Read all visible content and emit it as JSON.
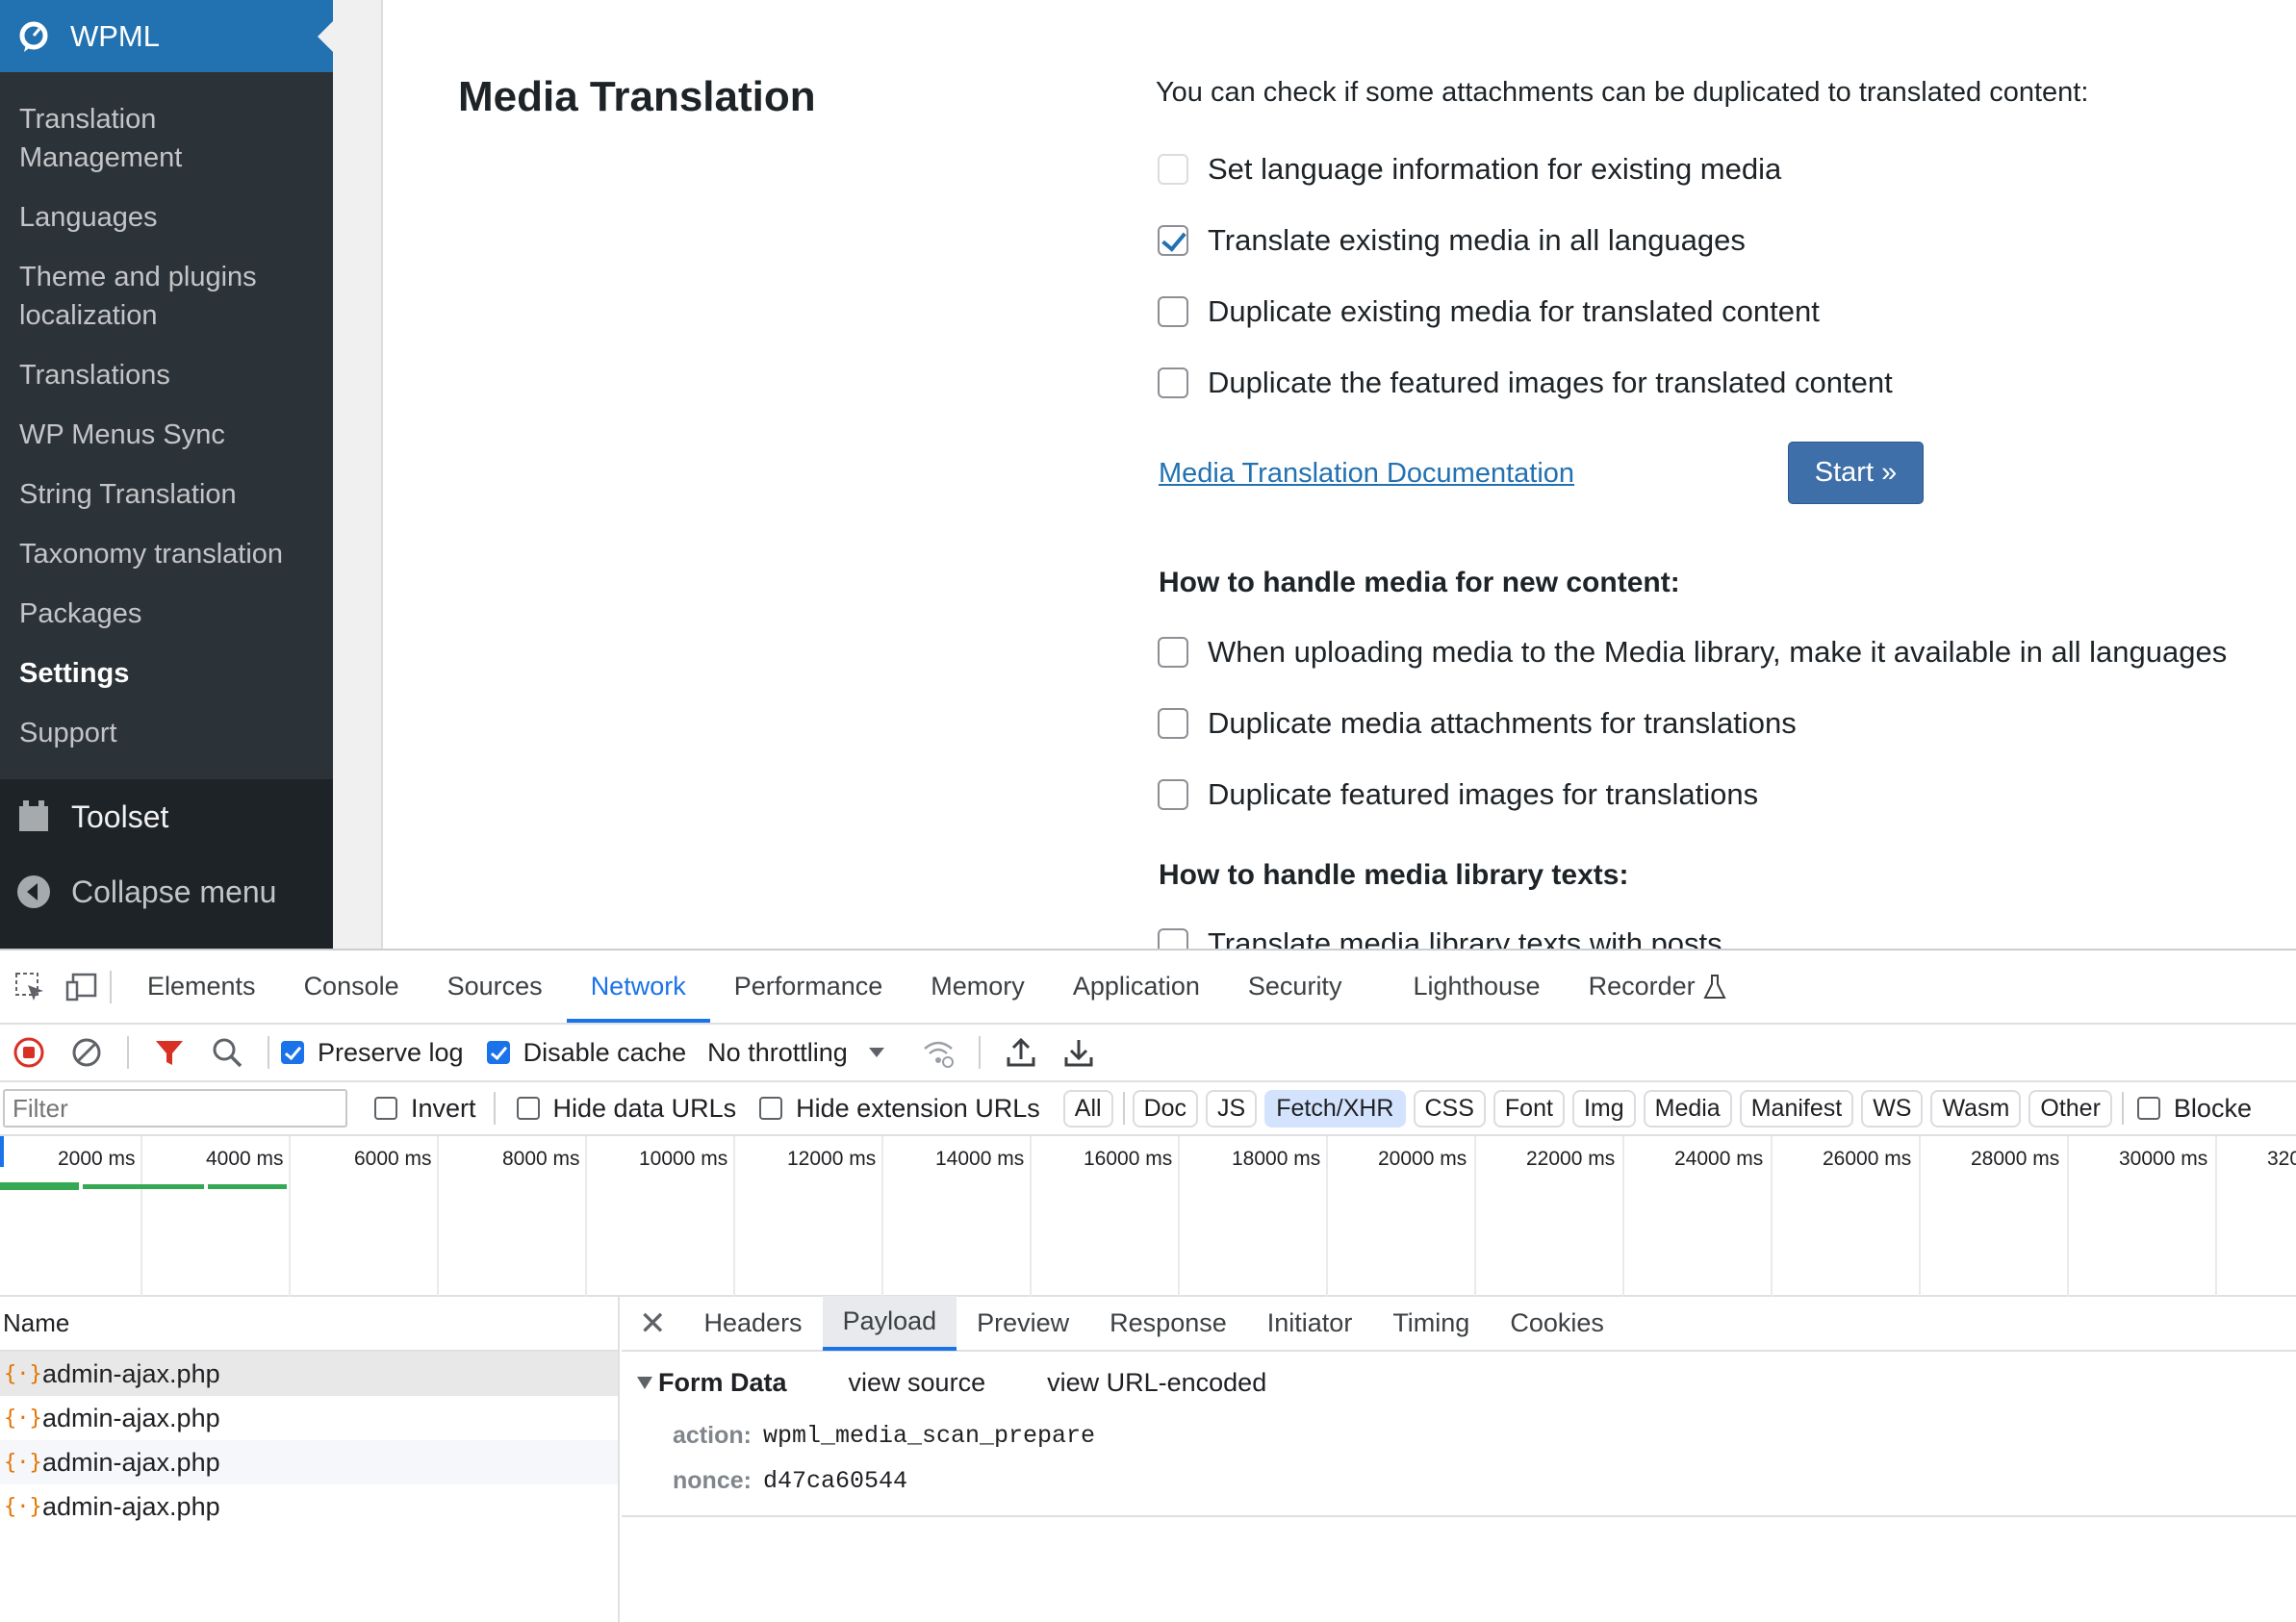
{
  "sidebar": {
    "plugin_name": "WPML",
    "items": [
      {
        "label": "Translation Management"
      },
      {
        "label": "Languages"
      },
      {
        "label": "Theme and plugins localization"
      },
      {
        "label": "Translations"
      },
      {
        "label": "WP Menus Sync"
      },
      {
        "label": "String Translation"
      },
      {
        "label": "Taxonomy translation"
      },
      {
        "label": "Packages"
      },
      {
        "label": "Settings",
        "current": true
      },
      {
        "label": "Support"
      }
    ],
    "toolset_label": "Toolset",
    "collapse_label": "Collapse menu"
  },
  "content": {
    "title": "Media Translation",
    "intro": "You can check if some attachments can be duplicated to translated content:",
    "existing_options": [
      {
        "label": "Set language information for existing media",
        "checked": false,
        "disabled": true
      },
      {
        "label": "Translate existing media in all languages",
        "checked": true
      },
      {
        "label": "Duplicate existing media for translated content",
        "checked": false
      },
      {
        "label": "Duplicate the featured images for translated content",
        "checked": false
      }
    ],
    "doc_link": "Media Translation Documentation",
    "start_button": "Start »",
    "new_content_heading": "How to handle media for new content:",
    "new_content_options": [
      {
        "label": "When uploading media to the Media library, make it available in all languages",
        "checked": false
      },
      {
        "label": "Duplicate media attachments for translations",
        "checked": false
      },
      {
        "label": "Duplicate featured images for translations",
        "checked": false
      }
    ],
    "library_texts_heading": "How to handle media library texts:",
    "library_texts_options": [
      {
        "label": "Translate media library texts with posts",
        "checked": false
      }
    ]
  },
  "devtools": {
    "tabs": [
      "Elements",
      "Console",
      "Sources",
      "Network",
      "Performance",
      "Memory",
      "Application",
      "Security",
      "Lighthouse",
      "Recorder"
    ],
    "active_tab": "Network",
    "toolbar": {
      "preserve_log": "Preserve log",
      "preserve_log_checked": true,
      "disable_cache": "Disable cache",
      "disable_cache_checked": true,
      "throttling": "No throttling"
    },
    "filter": {
      "placeholder": "Filter",
      "invert": "Invert",
      "hide_data_urls": "Hide data URLs",
      "hide_extension_urls": "Hide extension URLs",
      "chips": [
        "All",
        "Doc",
        "JS",
        "Fetch/XHR",
        "CSS",
        "Font",
        "Img",
        "Media",
        "Manifest",
        "WS",
        "Wasm",
        "Other"
      ],
      "active_chip": "Fetch/XHR",
      "blocked": "Blocke"
    },
    "timeline_ticks": [
      "2000 ms",
      "4000 ms",
      "6000 ms",
      "8000 ms",
      "10000 ms",
      "12000 ms",
      "14000 ms",
      "16000 ms",
      "18000 ms",
      "20000 ms",
      "22000 ms",
      "24000 ms",
      "26000 ms",
      "28000 ms",
      "30000 ms",
      "320"
    ],
    "requests_header": "Name",
    "requests": [
      "admin-ajax.php",
      "admin-ajax.php",
      "admin-ajax.php",
      "admin-ajax.php"
    ],
    "detail_tabs": [
      "Headers",
      "Payload",
      "Preview",
      "Response",
      "Initiator",
      "Timing",
      "Cookies"
    ],
    "active_detail_tab": "Payload",
    "payload": {
      "section_title": "Form Data",
      "view_source": "view source",
      "view_url_encoded": "view URL-encoded",
      "fields": [
        {
          "key": "action:",
          "value": "wpml_media_scan_prepare"
        },
        {
          "key": "nonce:",
          "value": "d47ca60544"
        }
      ]
    }
  }
}
